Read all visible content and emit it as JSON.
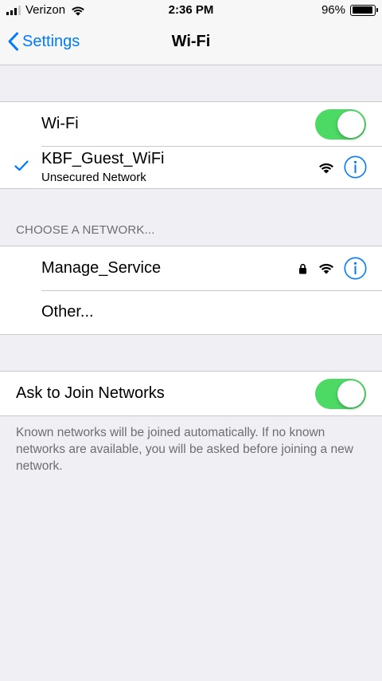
{
  "status_bar": {
    "carrier": "Verizon",
    "time": "2:36 PM",
    "battery": "96%",
    "battery_level": 0.96,
    "signal_bars": 3
  },
  "nav": {
    "back_label": "Settings",
    "title": "Wi-Fi"
  },
  "wifi_group": {
    "wifi_label": "Wi-Fi",
    "wifi_on": true,
    "connected": {
      "name": "KBF_Guest_WiFi",
      "subtitle": "Unsecured Network",
      "icons": [
        "checkmark-icon",
        "wifi-signal-icon",
        "info-icon"
      ]
    }
  },
  "networks": {
    "header": "CHOOSE A NETWORK...",
    "items": [
      {
        "name": "Manage_Service",
        "secured": true,
        "icons": [
          "lock-icon",
          "wifi-signal-icon",
          "info-icon"
        ]
      },
      {
        "name": "Other..."
      }
    ]
  },
  "ask_join": {
    "label": "Ask to Join Networks",
    "on": true,
    "footer": "Known networks will be joined automatically. If no known networks are available, you will be asked before joining a new network."
  },
  "colors": {
    "accent": "#007aff",
    "toggle_on": "#4cd964",
    "background": "#efeff4",
    "separator": "#c8c7cc",
    "secondary_text": "#6d6d72"
  }
}
